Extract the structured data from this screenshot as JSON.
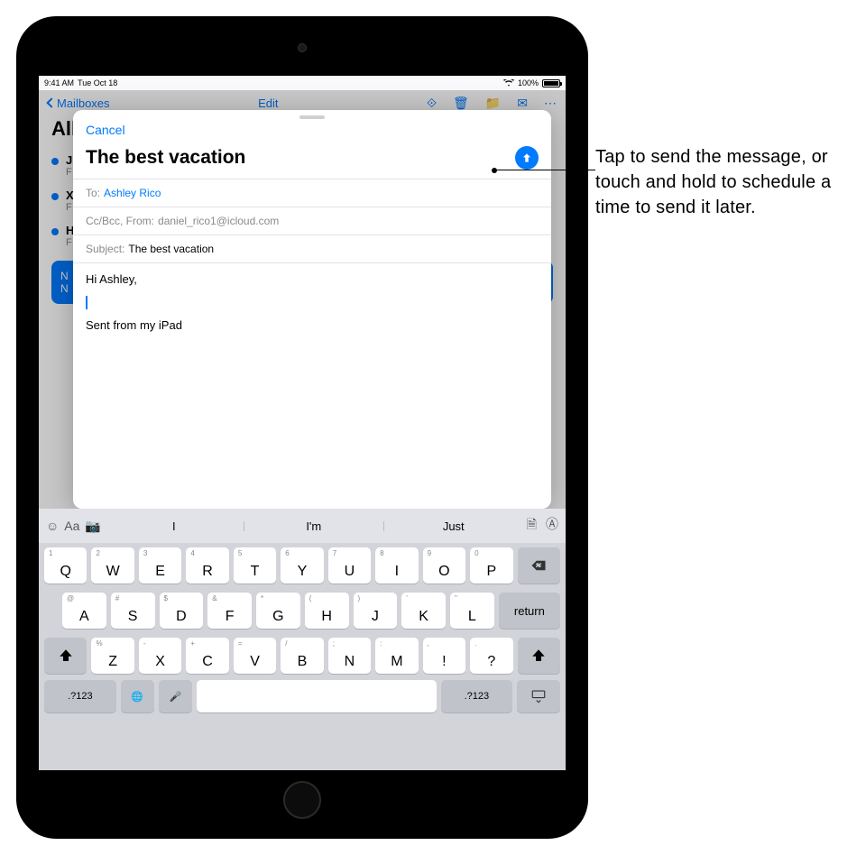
{
  "status": {
    "time": "9:41 AM",
    "date": "Tue Oct 18",
    "battery": "100%"
  },
  "mail_bg": {
    "back": "Mailboxes",
    "edit": "Edit",
    "title": "All Inboxes",
    "items": [
      {
        "sender": "J",
        "preview": "F"
      },
      {
        "sender": "X",
        "preview": "F"
      },
      {
        "sender": "H",
        "preview": "F"
      }
    ],
    "sel_line1": "N",
    "sel_line2": "N"
  },
  "compose": {
    "cancel": "Cancel",
    "title": "The best vacation",
    "to_label": "To:",
    "to_value": "Ashley Rico",
    "cc_label": "Cc/Bcc, From:",
    "cc_value": "daniel_rico1@icloud.com",
    "subj_label": "Subject:",
    "subj_value": "The best vacation",
    "greeting": "Hi Ashley,",
    "signature": "Sent from my iPad"
  },
  "predictions": {
    "s1": "I",
    "s2": "I'm",
    "s3": "Just"
  },
  "keys": {
    "row1": [
      {
        "m": "Q",
        "s": "1"
      },
      {
        "m": "W",
        "s": "2"
      },
      {
        "m": "E",
        "s": "3"
      },
      {
        "m": "R",
        "s": "4"
      },
      {
        "m": "T",
        "s": "5"
      },
      {
        "m": "Y",
        "s": "6"
      },
      {
        "m": "U",
        "s": "7"
      },
      {
        "m": "I",
        "s": "8"
      },
      {
        "m": "O",
        "s": "9"
      },
      {
        "m": "P",
        "s": "0"
      }
    ],
    "row2": [
      {
        "m": "A",
        "s": "@"
      },
      {
        "m": "S",
        "s": "#"
      },
      {
        "m": "D",
        "s": "$"
      },
      {
        "m": "F",
        "s": "&"
      },
      {
        "m": "G",
        "s": "*"
      },
      {
        "m": "H",
        "s": "("
      },
      {
        "m": "J",
        "s": ")"
      },
      {
        "m": "K",
        "s": "'"
      },
      {
        "m": "L",
        "s": "\""
      }
    ],
    "row3": [
      {
        "m": "Z",
        "s": "%"
      },
      {
        "m": "X",
        "s": "-"
      },
      {
        "m": "C",
        "s": "+"
      },
      {
        "m": "V",
        "s": "="
      },
      {
        "m": "B",
        "s": "/"
      },
      {
        "m": "N",
        "s": ";"
      },
      {
        "m": "M",
        "s": ":"
      },
      {
        "m": "!",
        "s": ","
      },
      {
        "m": "?",
        "s": "."
      }
    ],
    "numkey": ".?123",
    "return": "return"
  },
  "callout": "Tap to send the message, or touch and hold to schedule a time to send it later."
}
